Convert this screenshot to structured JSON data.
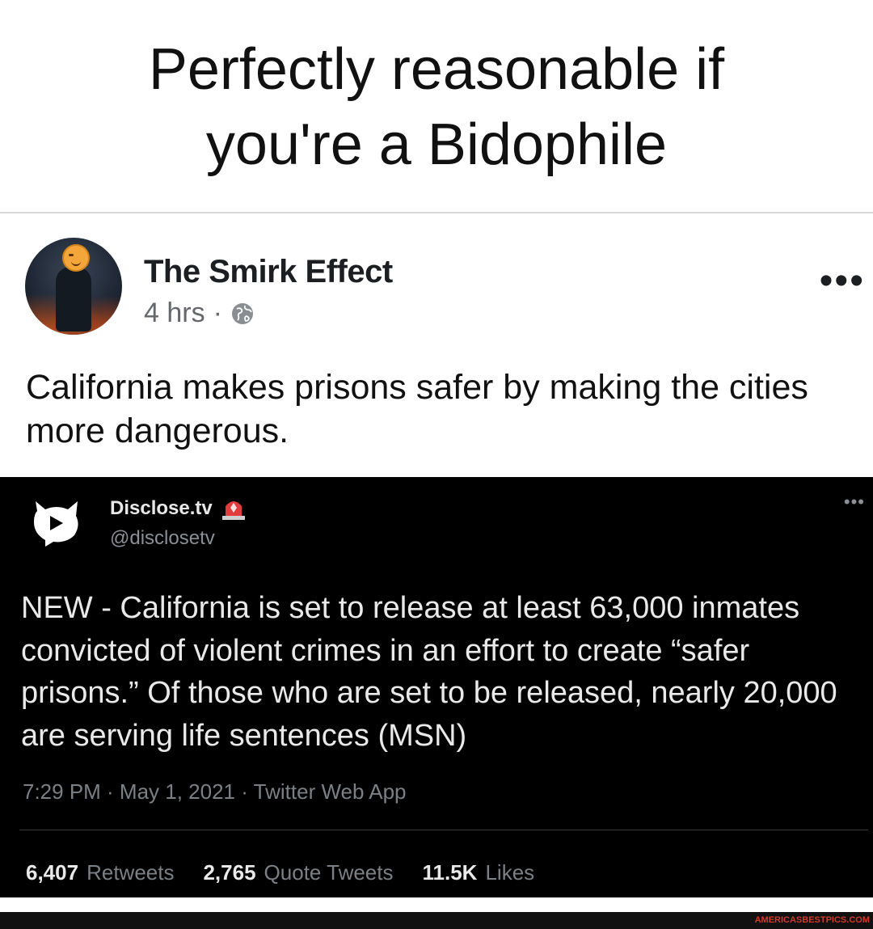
{
  "caption": {
    "line1": "Perfectly reasonable if",
    "line2": "you're a Bidophile"
  },
  "post": {
    "page_name": "The Smirk Effect",
    "time": "4 hrs",
    "separator": "·",
    "privacy_icon": "globe-icon",
    "more_icon": "ellipsis-icon",
    "avatar_emoji": "smirking-face",
    "text": "California makes prisons safer by making the cities more dangerous."
  },
  "tweet": {
    "name": "Disclose.tv",
    "badge_icon": "siren-icon",
    "handle": "@disclosetv",
    "more_icon": "ellipsis-icon",
    "text": "NEW - California is set to release at least 63,000 inmates convicted of violent crimes in an effort to create “safer prisons.” Of those who are set to be released, nearly 20,000 are serving life sentences (MSN)",
    "timestamp": "7:29 PM · May 1, 2021 · Twitter Web App",
    "stats": [
      {
        "count": "6,407",
        "label": "Retweets"
      },
      {
        "count": "2,765",
        "label": "Quote Tweets"
      },
      {
        "count": "11.5K",
        "label": "Likes"
      }
    ]
  },
  "watermark": "AMERICASBESTPICS.COM",
  "colors": {
    "tweet_background": "#000000",
    "watermark": "#d23a2a",
    "secondary_text": "#65676b"
  }
}
